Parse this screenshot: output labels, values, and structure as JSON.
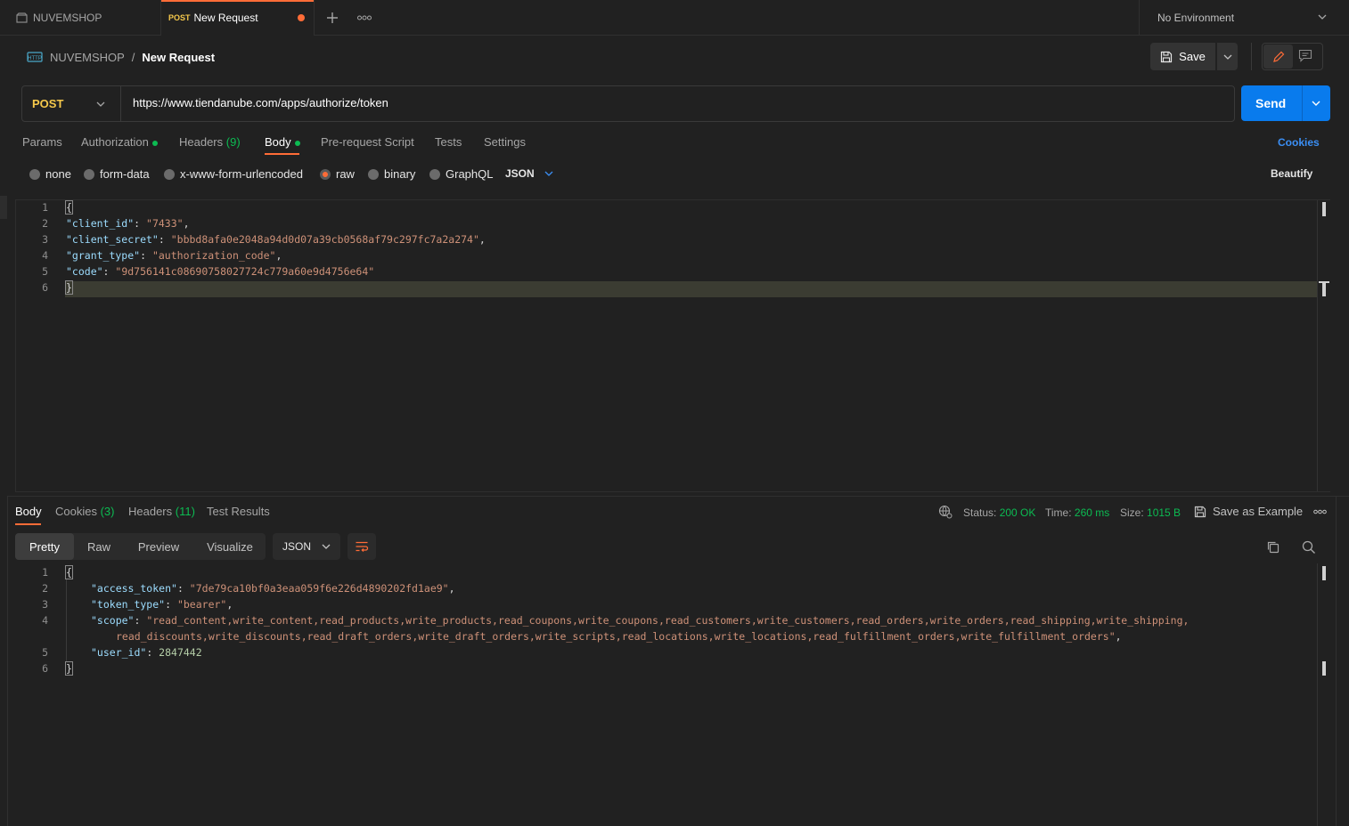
{
  "tabs": [
    {
      "label": "NUVEMSHOP"
    },
    {
      "method": "POST",
      "label": "New Request"
    }
  ],
  "environment": {
    "label": "No Environment"
  },
  "breadcrumb": {
    "collection": "NUVEMSHOP",
    "separator": "/",
    "request": "New Request"
  },
  "toolbar": {
    "save_label": "Save"
  },
  "request": {
    "method": "POST",
    "url": "https://www.tiendanube.com/apps/authorize/token",
    "send_label": "Send"
  },
  "request_tabs": {
    "params": "Params",
    "authorization": "Authorization",
    "headers": "Headers",
    "headers_count": "(9)",
    "body": "Body",
    "prerequest": "Pre-request Script",
    "tests": "Tests",
    "settings": "Settings",
    "cookies": "Cookies"
  },
  "body_types": {
    "none": "none",
    "form_data": "form-data",
    "urlencoded": "x-www-form-urlencoded",
    "raw": "raw",
    "binary": "binary",
    "graphql": "GraphQL",
    "format": "JSON",
    "beautify": "Beautify"
  },
  "request_body": {
    "line_numbers": [
      "1",
      "2",
      "3",
      "4",
      "5",
      "6"
    ],
    "open": "{",
    "close": "}",
    "k1": "\"client_id\"",
    "v1": "\"7433\"",
    "k2": "\"client_secret\"",
    "v2": "\"bbbd8afa0e2048a94d0d07a39cb0568af79c297fc7a2a274\"",
    "k3": "\"grant_type\"",
    "v3": "\"authorization_code\"",
    "k4": "\"code\"",
    "v4": "\"9d756141c08690758027724c779a60e9d4756e64\""
  },
  "response_tabs": {
    "body": "Body",
    "cookies": "Cookies",
    "cookies_count": "(3)",
    "headers": "Headers",
    "headers_count": "(11)",
    "test_results": "Test Results"
  },
  "response_meta": {
    "status_label": "Status:",
    "status": "200 OK",
    "time_label": "Time:",
    "time": "260 ms",
    "size_label": "Size:",
    "size": "1015 B",
    "save_example": "Save as Example"
  },
  "response_view": {
    "pretty": "Pretty",
    "raw": "Raw",
    "preview": "Preview",
    "visualize": "Visualize",
    "format": "JSON"
  },
  "response_body": {
    "line_numbers": [
      "1",
      "2",
      "3",
      "4",
      "",
      "5",
      "6"
    ],
    "open": "{",
    "close": "}",
    "k1": "\"access_token\"",
    "v1": "\"7de79ca10bf0a3eaa059f6e226d4890202fd1ae9\"",
    "k2": "\"token_type\"",
    "v2": "\"bearer\"",
    "k3": "\"scope\"",
    "v3a": "\"read_content,write_content,read_products,write_products,read_coupons,write_coupons,read_customers,write_customers,read_orders,write_orders,read_shipping,write_shipping,",
    "v3b": "read_discounts,write_discounts,read_draft_orders,write_draft_orders,write_scripts,read_locations,write_locations,read_fulfillment_orders,write_fulfillment_orders\"",
    "k4": "\"user_id\"",
    "v4": "2847442"
  },
  "colors": {
    "accent": "#ff6c37",
    "send": "#097bed",
    "success": "#0cbb52",
    "post": "#f5c84b"
  }
}
